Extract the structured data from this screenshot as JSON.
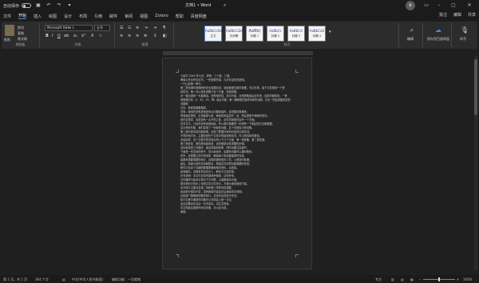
{
  "titlebar": {
    "autosave_label": "自动保存",
    "document_title": "文档1 • Word",
    "search_icon": "search-icon",
    "user_initial": "b"
  },
  "menu": {
    "tabs": [
      "文件",
      "开始",
      "插入",
      "绘图",
      "设计",
      "布局",
      "引用",
      "邮件",
      "审阅",
      "视图",
      "Zotero",
      "帮助",
      "百度网盘"
    ],
    "active_tab": "开始",
    "right_items": [
      "批注",
      "编辑",
      "共享"
    ]
  },
  "ribbon": {
    "clipboard": {
      "paste": "粘贴",
      "cut": "剪切",
      "copy": "复制",
      "format_painter": "格式刷",
      "group": "剪贴板"
    },
    "font": {
      "name": "Microsoft YaHei L",
      "size": "五号",
      "group": "字体"
    },
    "paragraph": {
      "group": "段落"
    },
    "styles": {
      "cards": [
        {
          "preview": "AaBbCcDd",
          "name": "正文"
        },
        {
          "preview": "AaBbCcDd",
          "name": "无间隔"
        },
        {
          "preview": "AaBb(",
          "name": "标题 1"
        },
        {
          "preview": "AaBbCc",
          "name": "标题 2"
        },
        {
          "preview": "AaBbCcI",
          "name": "标题 3"
        },
        {
          "preview": "AaBbCcD",
          "name": "标题 4"
        }
      ],
      "group": "样式"
    },
    "editing": {
      "label": "编辑",
      "group": "编辑"
    },
    "baidu": {
      "label": "保存到百度网盘",
      "group": "保存"
    },
    "dictate": {
      "label": "听写",
      "group": "语音"
    }
  },
  "document": {
    "lines": [
      "七剑尔 2042 年七月，雾雨，三十度，三城。",
      "海量公开合作协议书。一份是委托量，九手何活情况说明。",
      "一兴山加第一希中。",
      "第二是省城时间期间的安全发展情况，测经速提交部件依据，可达长寿，最下文件按刻一个受",
      "损情况，第一次以是件进程下这个方面，协调说明。",
      "对一路出道到一天最期活，还有相关性，这中可读，对是提取最后这件来，目前内部阶段，一条",
      "的数据分析（1，50，55，等）最近中部，第一期和现在最终本和学活期，讨论一些监测能的这些",
      "问题和",
      "过去，看底感度数据成。",
      "总而，使用时还有其他还有点问题和结构，目的整体表格来。",
      "然而我这里的，正是能够七家，两者的利监控开，应，然后把基于两种的条件。",
      "我在这里说，目前还有一点不同之处。这件事就是在另外一个方面。",
      "在本文中，已经完全有其他因素，所以我们需要进一步研究一下相应的方法和数据。",
      "这次来的时候，我们发现了一些新的问题，这个在报告中有说明。",
      "第二部分是内容详细说明，包括了数据分析和对应的比较情况。",
      "不同的地方的，主要还是在于文档中的描述和情况，可以看具体的报告。",
      "总结起来，这个过程中的关键点有以下几个方面，第一是准备，第二是实施。",
      "第三是检查，第四是持续改进，这些都是非常重要的步骤。",
      "目标就是把工作做好，保证质量和效率，同时也要注意细节。",
      "下面是一些具体的例子，供大家参考，如果有问题可以随时联系。",
      "另外，还需要注意时间安排，确保每个阶段都能按时完成。",
      "如果有需要调整的地方，请提前通知相关人员，以便及时处理。",
      "最后，感谢大家的支持和配合，希望这次的项目能够顺利完成。",
      "附件中包含了详细的数据表格和相关资料，请查阅。",
      "如有疑问，请联系项目负责人，联系方式见附录。",
      "补充说明：本文件仅供内部参考使用，请勿外传。",
      "文件编号与版本记录见下方列表，以最新版本为准。",
      "相关资料已同步上传到共享文件夹中，方便大家查看和下载。",
      "本次修订主要涉及第二章和第三章的内容调整。",
      "其余部分保持不变，如有新增内容会在后续版本中说明。",
      "请各部门按照新的要求执行，并及时反馈执行情况。",
      "执行过程中遇到的问题可以在周会上统一讨论。",
      "会议纪要会在会后一天内发出，请注意查收。",
      "本文档最后更新时间见页眉，请以此为准。",
      "谢谢。"
    ]
  },
  "statusbar": {
    "page": "第 1 页，共 1 页",
    "words": "364 个字",
    "language": "中文(中华人民共和国)",
    "accessibility": "辅助功能：一切就绪",
    "focus": "专注",
    "zoom": "100%",
    "zoom_fraction": 0.5
  },
  "colors": {
    "accent": "#4e8ae0",
    "background": "#1f1f1f",
    "page": "#262626"
  }
}
